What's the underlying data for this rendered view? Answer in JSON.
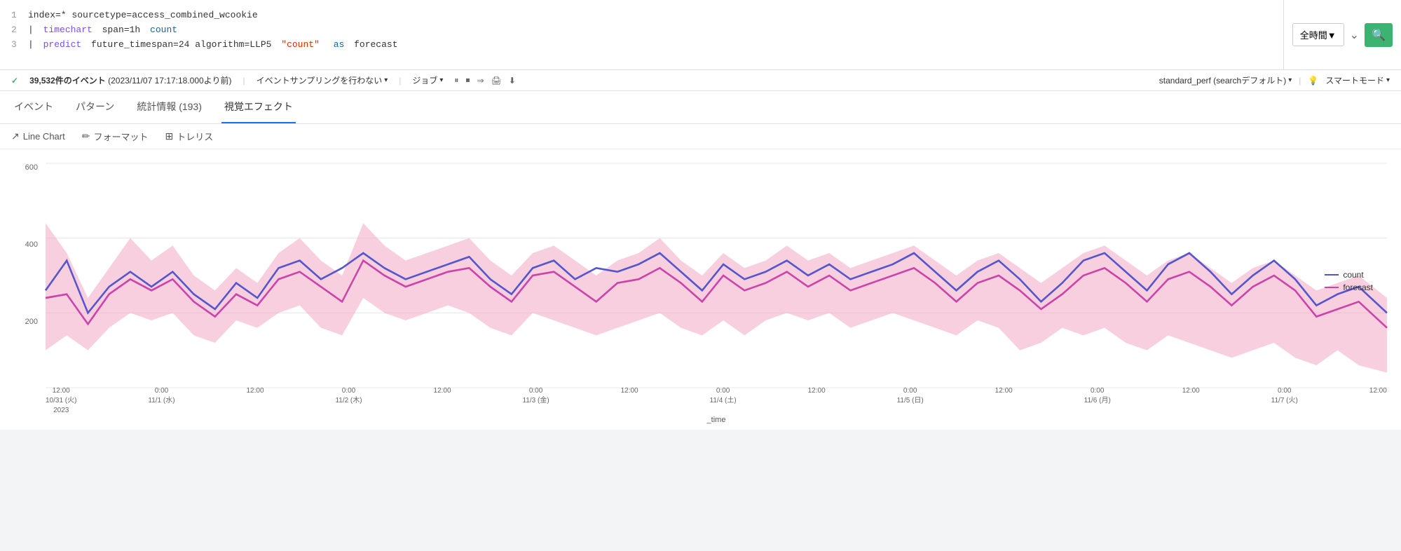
{
  "query": {
    "lines": [
      {
        "num": "1",
        "content": [
          {
            "type": "plain",
            "text": "index=* sourcetype=access_combined_wcookie"
          }
        ]
      },
      {
        "num": "2",
        "content": [
          {
            "type": "plain",
            "text": "| "
          },
          {
            "type": "cmd",
            "text": "timechart"
          },
          {
            "type": "plain",
            "text": " span=1h "
          },
          {
            "type": "keyword",
            "text": "count"
          }
        ]
      },
      {
        "num": "3",
        "content": [
          {
            "type": "plain",
            "text": "| "
          },
          {
            "type": "cmd",
            "text": "predict"
          },
          {
            "type": "plain",
            "text": " future_timespan=24 algorithm=LLP5 "
          },
          {
            "type": "string",
            "text": "\"count\""
          },
          {
            "type": "plain",
            "text": " "
          },
          {
            "type": "keyword",
            "text": "as"
          },
          {
            "type": "plain",
            "text": " forecast"
          }
        ]
      }
    ],
    "time_selector": "全時間▼",
    "search_icon": "🔍"
  },
  "status": {
    "check": "✓",
    "events": "39,532件のイベント",
    "date": "(2023/11/07 17:17:18.000より前)",
    "sampling": "イベントサンプリングを行わない",
    "jobs": "ジョブ",
    "perf": "standard_perf (searchデフォルト)",
    "smart": "スマートモード"
  },
  "tabs": [
    {
      "label": "イベント",
      "active": false
    },
    {
      "label": "パターン",
      "active": false
    },
    {
      "label": "統計情報 (193)",
      "active": false
    },
    {
      "label": "視覚エフェクト",
      "active": true
    }
  ],
  "sub_toolbar": [
    {
      "icon": "⬆",
      "label": "Line Chart"
    },
    {
      "icon": "✏",
      "label": "フォーマット"
    },
    {
      "icon": "⊞",
      "label": "トレリス"
    }
  ],
  "chart": {
    "y_labels": [
      "600",
      "400",
      "200",
      ""
    ],
    "x_labels": [
      {
        "line1": "12:00",
        "line2": "10/31 (火)",
        "line3": "2023"
      },
      {
        "line1": "0:00",
        "line2": "11/1 (水)",
        "line3": ""
      },
      {
        "line1": "12:00",
        "line2": "",
        "line3": ""
      },
      {
        "line1": "0:00",
        "line2": "11/2 (木)",
        "line3": ""
      },
      {
        "line1": "12:00",
        "line2": "",
        "line3": ""
      },
      {
        "line1": "0:00",
        "line2": "11/3 (金)",
        "line3": ""
      },
      {
        "line1": "12:00",
        "line2": "",
        "line3": ""
      },
      {
        "line1": "0:00",
        "line2": "11/4 (土)",
        "line3": ""
      },
      {
        "line1": "12:00",
        "line2": "",
        "line3": ""
      },
      {
        "line1": "0:00",
        "line2": "11/5 (日)",
        "line3": ""
      },
      {
        "line1": "12:00",
        "line2": "",
        "line3": ""
      },
      {
        "line1": "0:00",
        "line2": "11/6 (月)",
        "line3": ""
      },
      {
        "line1": "12:00",
        "line2": "",
        "line3": ""
      },
      {
        "line1": "0:00",
        "line2": "11/7 (火)",
        "line3": ""
      },
      {
        "line1": "12:00",
        "line2": "",
        "line3": ""
      }
    ],
    "x_title": "_time",
    "legend": [
      {
        "label": "count",
        "class": "count"
      },
      {
        "label": "forecast",
        "class": "forecast"
      }
    ]
  }
}
